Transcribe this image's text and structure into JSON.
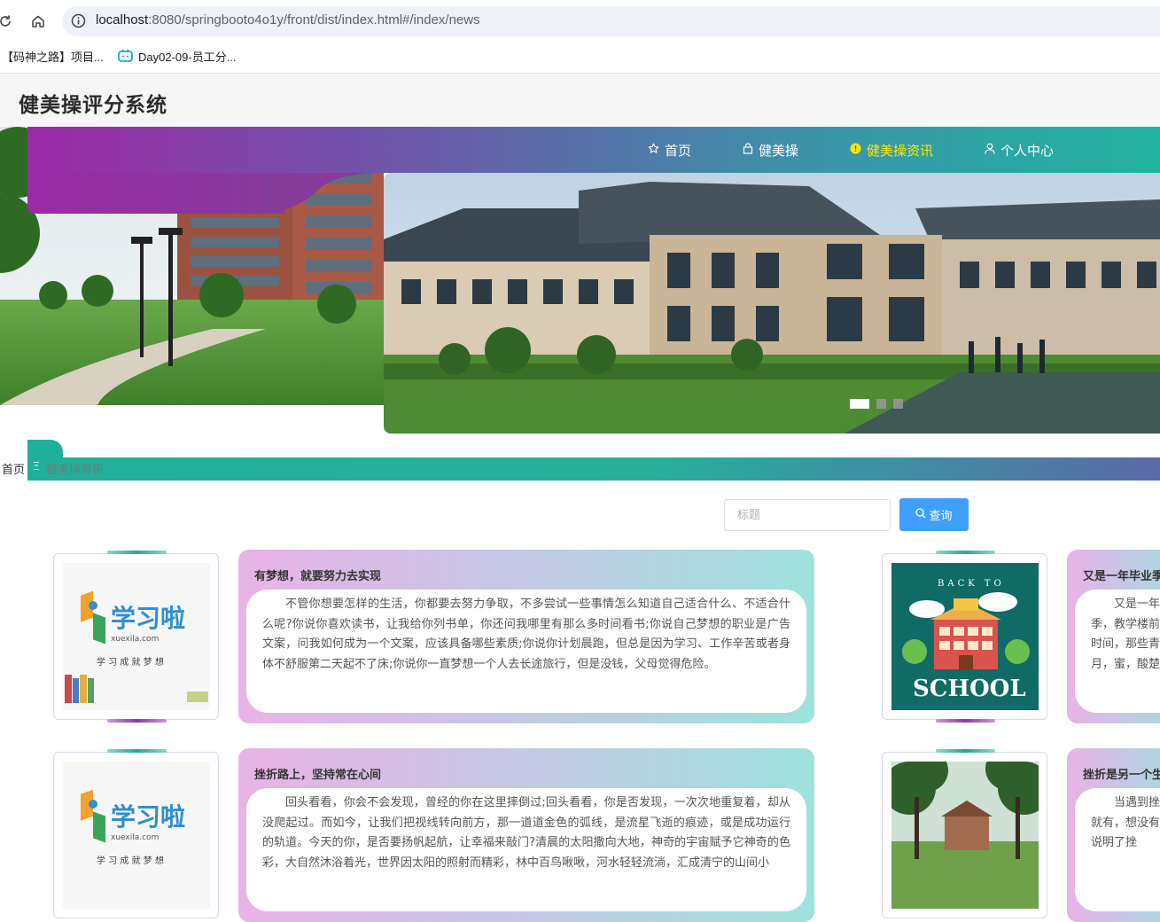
{
  "browser": {
    "url_host": "localhost",
    "url_rest": ":8080/springbooto4o1y/front/dist/index.html#/index/news",
    "bookmarks": [
      {
        "label": "【码神之路】项目..."
      },
      {
        "label": "Day02-09-员工分..."
      }
    ]
  },
  "site": {
    "title": "健美操评分系统"
  },
  "nav": {
    "items": [
      {
        "label": "首页",
        "icon": "star-icon",
        "active": false
      },
      {
        "label": "健美操",
        "icon": "lock-bag-icon",
        "active": false
      },
      {
        "label": "健美操资讯",
        "icon": "info-circle-icon",
        "active": true
      },
      {
        "label": "个人中心",
        "icon": "user-icon",
        "active": false
      }
    ]
  },
  "breadcrumb": {
    "home": "首页",
    "separator": "Ξ",
    "current": "健美操资讯"
  },
  "search": {
    "placeholder": "标题",
    "button_label": "查询"
  },
  "logo_text": {
    "brand": "学习啦",
    "domain": "xuexila.com",
    "slogan": "学 习 成 就 梦 想"
  },
  "school_text": {
    "top": "BACK TO",
    "bottom": "SCHOOL"
  },
  "news": [
    {
      "title": "有梦想，就要努力去实现",
      "desc": "不管你想要怎样的生活，你都要去努力争取，不多尝试一些事情怎么知道自己适合什么、不适合什么呢?你说你喜欢读书，让我给你列书单，你还问我哪里有那么多时间看书;你说自己梦想的职业是广告文案，问我如何成为一个文案，应该具备哪些素质;你说你计划晨跑，但总是因为学习、工作辛苦或者身体不舒服第二天起不了床;你说你一直梦想一个人去长途旅行，但是没钱，父母觉得危险。"
    },
    {
      "title": "又是一年毕业季",
      "desc": "又是一年毕业季，教学楼前面，时间，那些青葱岁月，蜜，酸楚，苦"
    },
    {
      "title": "挫折路上，坚持常在心间",
      "desc": "回头看看，你会不会发现，曾经的你在这里摔倒过;回头看看，你是否发现，一次次地重复着，却从没爬起过。而如今，让我们把视线转向前方，那一道道金色的弧线，是流星飞逝的痕迹，或是成功运行的轨道。今天的你，是否要扬帆起航，让幸福来敲门?清晨的太阳撒向大地，神奇的宇宙赋予它神奇的色彩，大自然沐浴着光，世界因太阳的照射而精彩，林中百鸟啾啾，河水轻轻流淌，汇成清宁的山间小"
    },
    {
      "title": "挫折是另一个生",
      "desc": "当遇到挫折，就有，想没有象地说明了挫"
    }
  ],
  "banner": {
    "slides": 3,
    "active_slide": 1
  }
}
